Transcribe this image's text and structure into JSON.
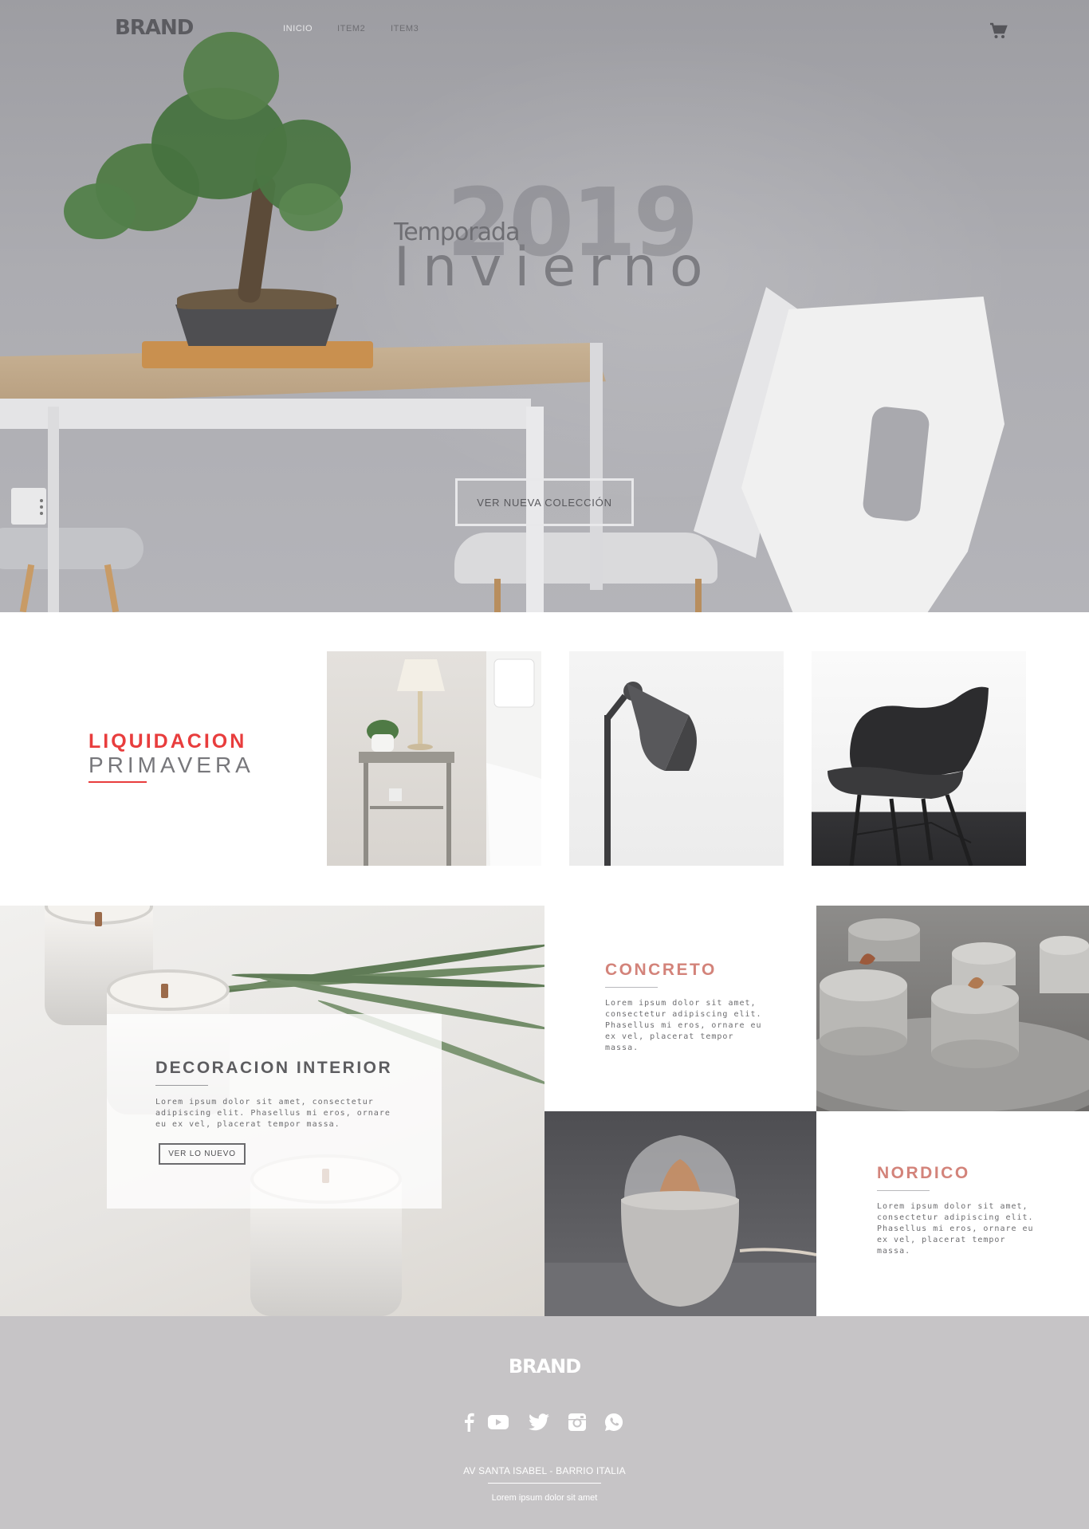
{
  "nav": {
    "brand": "BRAND",
    "items": [
      {
        "label": "INICIO"
      },
      {
        "label": "ITEM2"
      },
      {
        "label": "ITEM3"
      }
    ],
    "cart_icon": "shopping-cart-icon"
  },
  "hero": {
    "year": "2019",
    "season_label": "Temporada",
    "season_name": "Invierno",
    "cta_label": "VER NUEVA COLECCIÓN"
  },
  "sale": {
    "title": "LIQUIDACION",
    "subtitle": "PRIMAVERA",
    "accent": "#e83d3d"
  },
  "features": {
    "deco": {
      "title": "DECORACION INTERIOR",
      "text": "Lorem ipsum dolor sit amet, consectetur adipiscing elit. Phasellus mi eros, ornare eu ex vel, placerat tempor massa.",
      "button": "VER LO NUEVO"
    },
    "concreto": {
      "title": "CONCRETO",
      "text": "Lorem ipsum dolor sit amet, consectetur adipiscing elit. Phasellus mi eros, ornare eu ex vel, placerat tempor massa."
    },
    "nordico": {
      "title": "NORDICO",
      "text": "Lorem ipsum dolor sit amet, consectetur adipiscing elit. Phasellus mi eros, ornare eu ex vel, placerat tempor massa."
    },
    "title_color": "#d3837a"
  },
  "footer": {
    "brand": "BRAND",
    "social_icons": [
      "facebook-icon",
      "youtube-icon",
      "twitter-icon",
      "instagram-icon",
      "whatsapp-icon"
    ],
    "address": "AV SANTA ISABEL - BARRIO ITALIA",
    "tagline": "Lorem ipsum dolor sit amet"
  }
}
